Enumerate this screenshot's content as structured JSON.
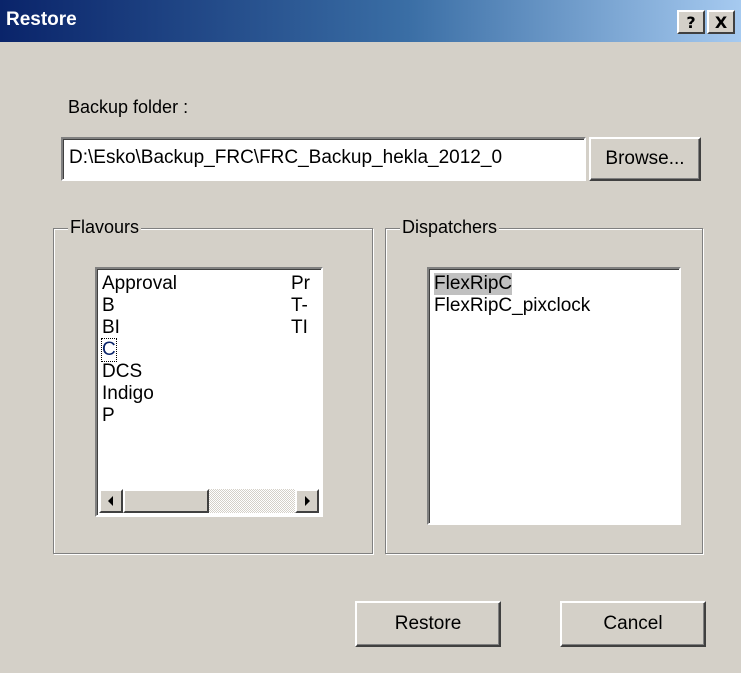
{
  "window": {
    "title": "Restore",
    "help_label": "?",
    "close_label": "X"
  },
  "backup": {
    "label": "Backup folder :",
    "path_value": "D:\\Esko\\Backup_FRC\\FRC_Backup_hekla_2012_0",
    "browse_label": "Browse..."
  },
  "flavours": {
    "label": "Flavours",
    "col1": [
      "Approval",
      "B",
      "BI",
      "C",
      "DCS",
      "Indigo",
      "P"
    ],
    "col2": [
      "Pr",
      "T-",
      "TI"
    ],
    "selected_index": 3
  },
  "dispatchers": {
    "label": "Dispatchers",
    "items": [
      "FlexRipC",
      "FlexRipC_pixclock"
    ],
    "selected_index": 0
  },
  "actions": {
    "restore_label": "Restore",
    "cancel_label": "Cancel"
  }
}
